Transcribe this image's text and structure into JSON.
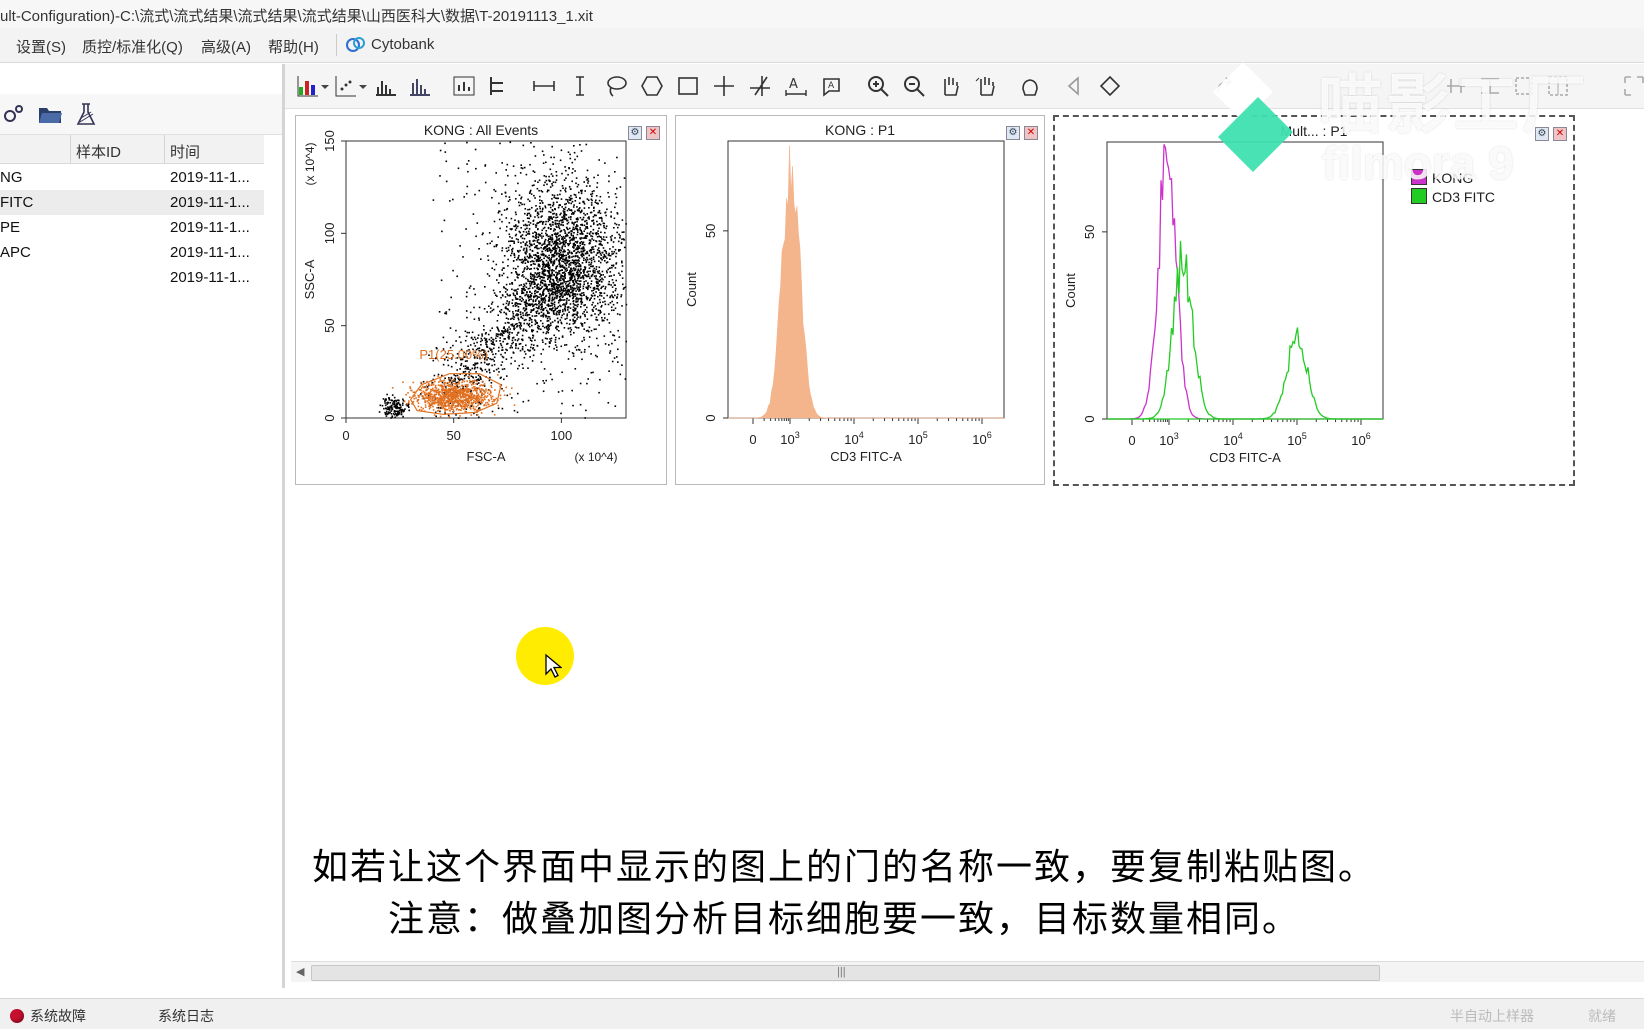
{
  "window": {
    "title": "ult-Configuration)-C:\\流式\\流式结果\\流式结果\\流式结果\\山西医科大\\数据\\T-20191113_1.xit"
  },
  "menu": {
    "items": [
      "设置(S)",
      "质控/标准化(Q)",
      "高级(A)",
      "帮助(H)"
    ],
    "cytobank": "Cytobank"
  },
  "sample_list": {
    "columns": [
      "样本ID",
      "时间"
    ],
    "rows": [
      {
        "name": "NG",
        "time": "2019-11-1..."
      },
      {
        "name": "FITC",
        "time": "2019-11-1..."
      },
      {
        "name": "PE",
        "time": "2019-11-1..."
      },
      {
        "name": "APC",
        "time": "2019-11-1..."
      },
      {
        "name": "",
        "time": "2019-11-1..."
      }
    ],
    "selected_index": 1
  },
  "plots": [
    {
      "title": "KONG : All Events",
      "settings_icon": "settings-icon",
      "close_icon": "close-icon"
    },
    {
      "title": "KONG : P1",
      "settings_icon": "settings-icon",
      "close_icon": "close-icon"
    },
    {
      "title": "Mult... : P1",
      "legend": [
        "KONG",
        "CD3 FITC"
      ],
      "settings_icon": "settings-icon",
      "close_icon": "close-icon"
    }
  ],
  "chart_data": [
    {
      "type": "scatter",
      "title": "KONG : All Events",
      "xlabel": "FSC-A",
      "ylabel": "SSC-A",
      "x_multiplier": "(x 10^4)",
      "y_multiplier": "(x 10^4)",
      "xlim": [
        0,
        130
      ],
      "ylim": [
        0,
        150
      ],
      "xticks": [
        "0",
        "50",
        "100"
      ],
      "yticks": [
        "0",
        "50",
        "100",
        "150"
      ],
      "gate": {
        "label": "P1(25.00%)",
        "color": "#e07020"
      },
      "point_color": "#000000"
    },
    {
      "type": "histogram",
      "title": "KONG : P1",
      "xlabel": "CD3 FITC-A",
      "ylabel": "Count",
      "xticks": [
        "0",
        "10^3",
        "10^4",
        "10^5",
        "10^6"
      ],
      "yticks": [
        "0",
        "50"
      ],
      "fill_color": "#f4b48c",
      "peak_x": "10^3",
      "peak_count": 68
    },
    {
      "type": "histogram-overlay",
      "title": "Mult... : P1",
      "xlabel": "CD3 FITC-A",
      "ylabel": "Count",
      "xticks": [
        "0",
        "10^3",
        "10^4",
        "10^5",
        "10^6"
      ],
      "yticks": [
        "0",
        "50"
      ],
      "series": [
        {
          "name": "KONG",
          "color": "#cc33cc",
          "peaks": [
            {
              "x": "10^3",
              "count": 68
            }
          ]
        },
        {
          "name": "CD3 FITC",
          "color": "#22cc22",
          "peaks": [
            {
              "x": "10^3",
              "count": 42
            },
            {
              "x": "10^5",
              "count": 22
            }
          ]
        }
      ]
    }
  ],
  "status": {
    "fault": "系统故障",
    "log": "系统日志",
    "right1": "半自动上样器",
    "right2": "就绪"
  },
  "subtitles": [
    "如若让这个界面中显示的图上的门的名称一致，要复制粘贴图。",
    "注意：做叠加图分析目标细胞要一致，目标数量相同。"
  ],
  "watermark": {
    "line1": "喵影工厂",
    "line2": "filmora 9"
  },
  "colors": {
    "accent": "#e07020",
    "cursor_highlight": "#ffec00",
    "watermark_logo": "#3fe0b0"
  }
}
